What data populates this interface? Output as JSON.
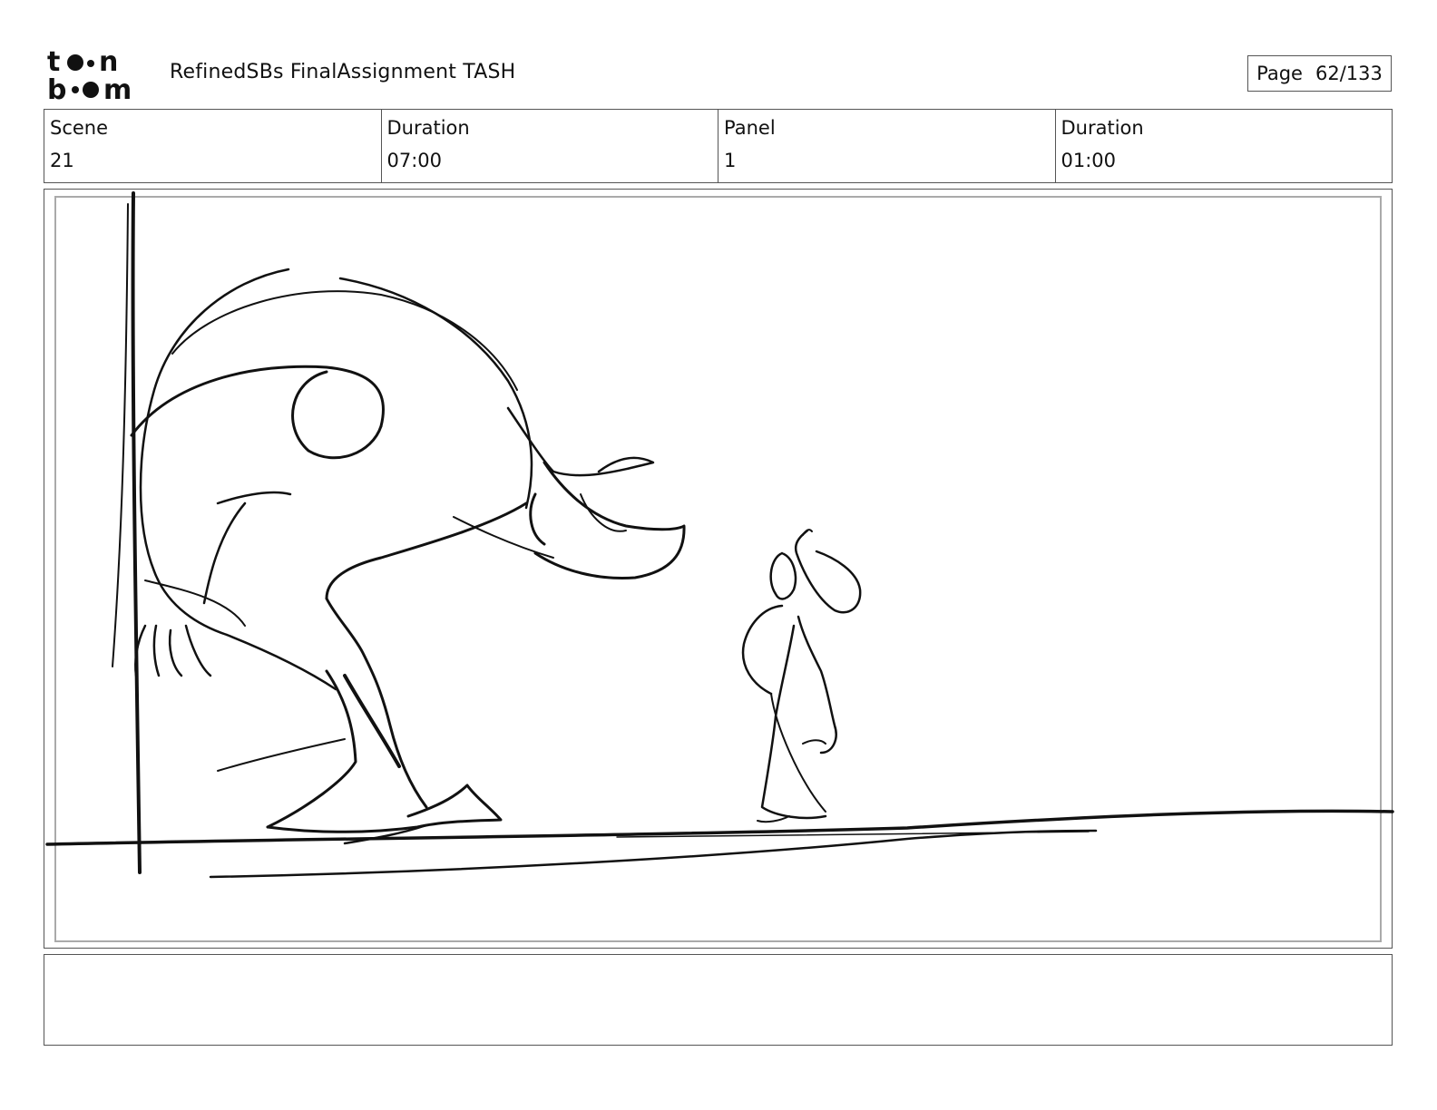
{
  "header": {
    "logo_text": "toon boom",
    "document_title": "RefinedSBs FinalAssignment TASH",
    "page_label": "Page",
    "page_value": "62/133"
  },
  "info": {
    "scene_label": "Scene",
    "scene_value": "21",
    "scene_duration_label": "Duration",
    "scene_duration_value": "07:00",
    "panel_label": "Panel",
    "panel_value": "1",
    "panel_duration_label": "Duration",
    "panel_duration_value": "01:00"
  },
  "notes": {
    "text": ""
  }
}
